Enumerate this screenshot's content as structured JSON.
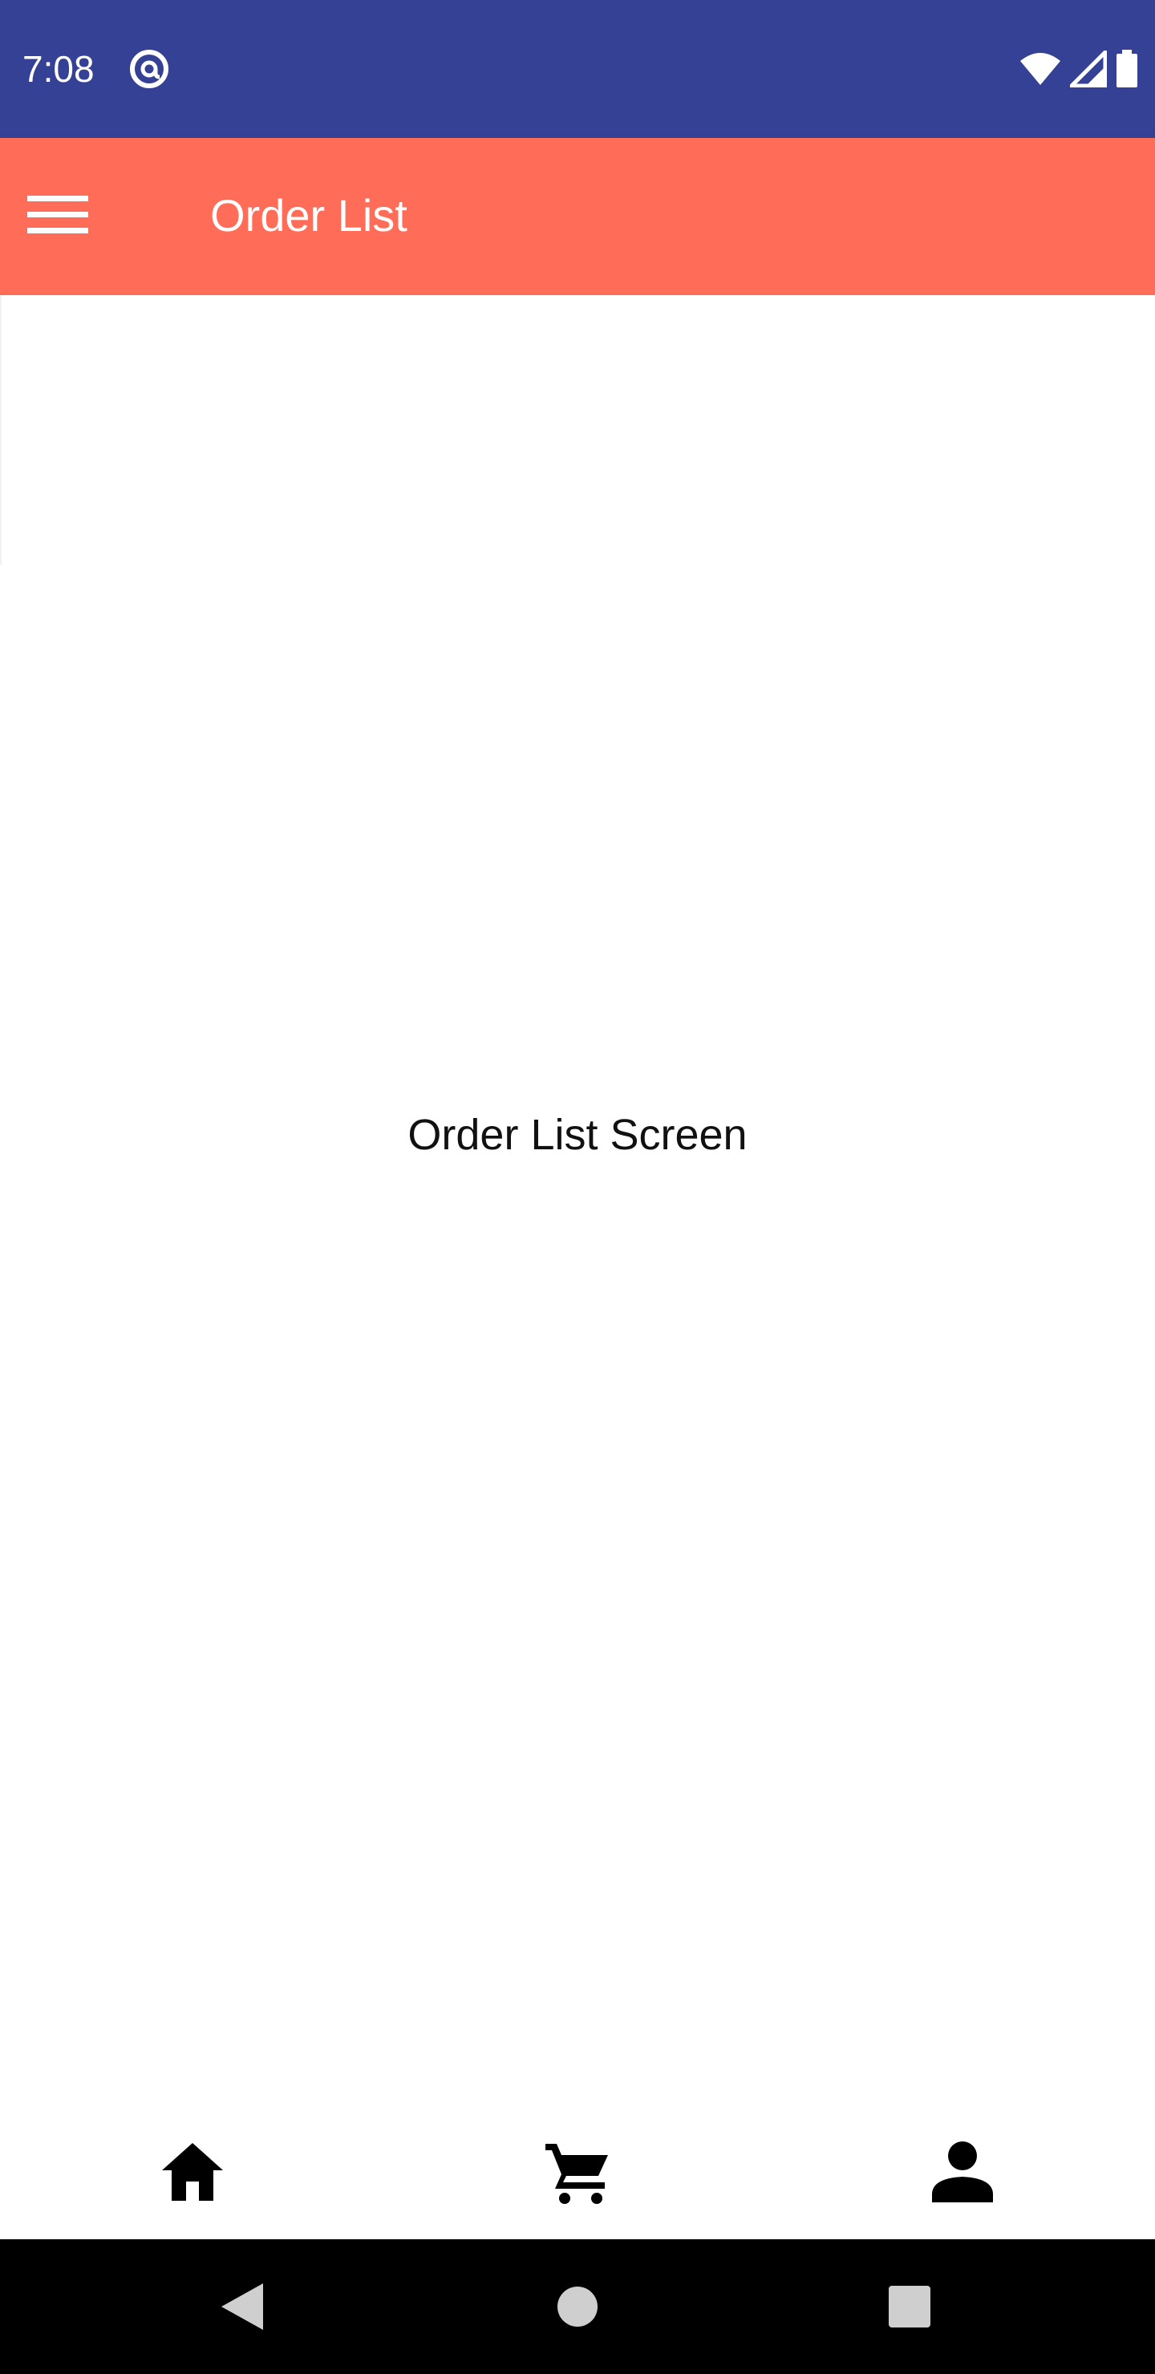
{
  "status_bar": {
    "time": "7:08",
    "left_icon": "at-sign-notification-icon",
    "right_icons": [
      "wifi-icon",
      "cellular-signal-icon",
      "battery-icon"
    ],
    "background_color": "#354194"
  },
  "app_bar": {
    "title": "Order List",
    "menu_icon": "hamburger-menu-icon",
    "background_color": "#ff6c57"
  },
  "content": {
    "label": "Order List Screen"
  },
  "bottom_nav": {
    "items": [
      {
        "icon": "home-icon"
      },
      {
        "icon": "shopping-cart-icon"
      },
      {
        "icon": "person-icon"
      }
    ]
  },
  "system_nav": {
    "buttons": [
      "back-triangle-icon",
      "home-circle-icon",
      "recents-square-icon"
    ]
  }
}
